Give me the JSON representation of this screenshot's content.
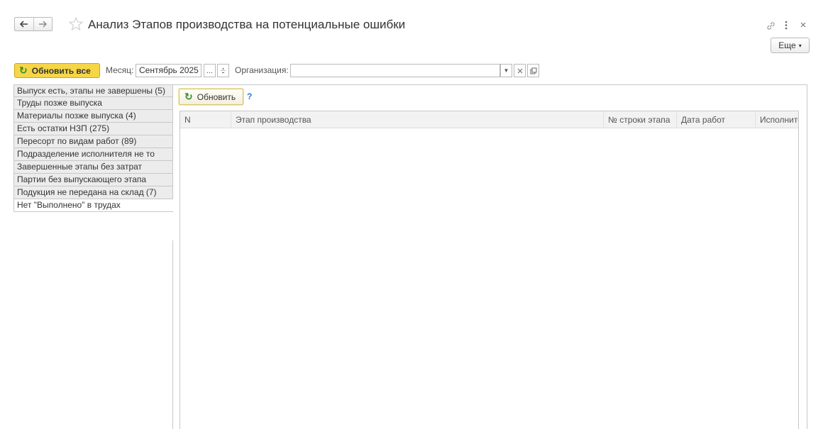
{
  "window": {
    "title": "Анализ Этапов производства на потенциальные ошибки",
    "more_label": "Еще"
  },
  "toolbar": {
    "refresh_all_label": "Обновить все",
    "month_label": "Месяц:",
    "month_value": "Сентябрь 2025",
    "month_picker_label": "...",
    "organization_label": "Организация:",
    "organization_value": ""
  },
  "checks": [
    {
      "label": "Выпуск есть, этапы не завершены (5)"
    },
    {
      "label": "Труды позже выпуска"
    },
    {
      "label": "Материалы позже выпуска (4)"
    },
    {
      "label": "Есть остатки НЗП (275)"
    },
    {
      "label": "Пересорт по видам работ (89)"
    },
    {
      "label": "Подразделение исполнителя не то"
    },
    {
      "label": "Завершенные этапы без затрат"
    },
    {
      "label": "Партии без выпускающего этапа"
    },
    {
      "label": "Подукция не передана на склад (7)"
    },
    {
      "label": "Нет \"Выполнено\" в трудах"
    }
  ],
  "panel": {
    "refresh_label": "Обновить",
    "help_label": "?",
    "columns": [
      "N",
      "Этап производства",
      "№ строки этапа",
      "Дата работ",
      "Исполните"
    ]
  },
  "colors": {
    "accent_yellow": "#f6d646",
    "refresh_green": "#2c8a2c",
    "help_blue": "#2e7bd1"
  }
}
